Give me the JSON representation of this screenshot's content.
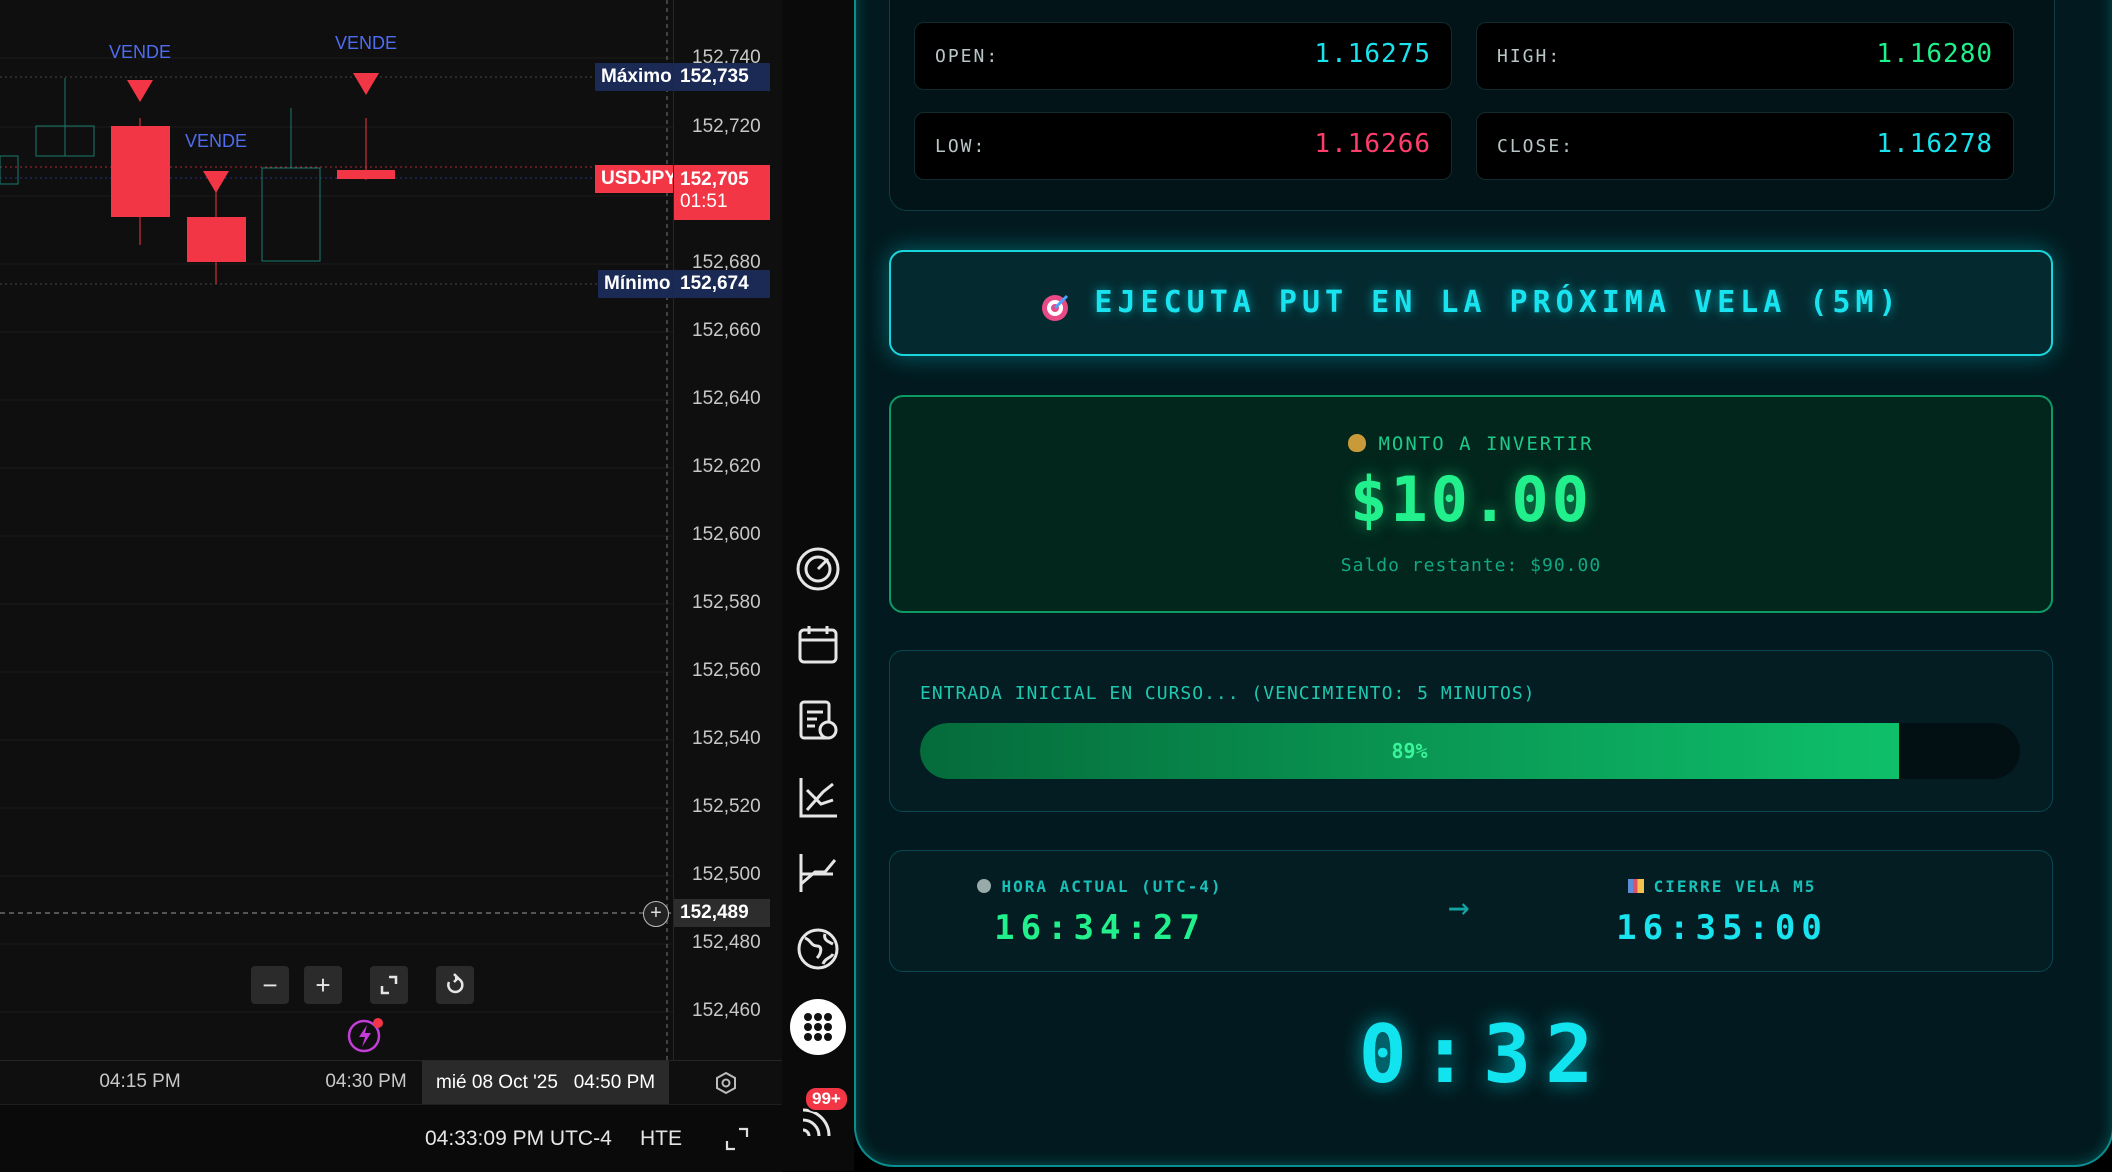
{
  "chart": {
    "signals": [
      "VENDE",
      "VENDE",
      "VENDE"
    ],
    "price_ticks": [
      "152,740",
      "152,720",
      "152,680",
      "152,660",
      "152,640",
      "152,620",
      "152,600",
      "152,580",
      "152,560",
      "152,540",
      "152,520",
      "152,500",
      "152,480",
      "152,460"
    ],
    "max_label": "Máximo",
    "max_value": "152,735",
    "symbol": "USDJPY",
    "current_price": "152,705",
    "countdown": "01:51",
    "min_label": "Mínimo",
    "min_value": "152,674",
    "crosshair_price": "152,489",
    "time_ticks": [
      "04:15 PM",
      "04:30 PM"
    ],
    "time_current": "mié 08 Oct '25   04:50 PM",
    "clock": "04:33:09 PM UTC-4",
    "exchange": "HTE",
    "colors": {
      "bear": "#f23645",
      "bull": "#1a7a6e",
      "signal": "#4e6cf0"
    }
  },
  "toolbar": {
    "icons": [
      "speedometer-icon",
      "calendar-icon",
      "news-icon",
      "chart-pattern-icon",
      "indicator-icon",
      "globe-icon",
      "apps-grid-icon",
      "broadcast-icon"
    ],
    "badge": "99+"
  },
  "panel": {
    "ohlc": [
      {
        "label": "OPEN:",
        "value": "1.16275",
        "color": "#19e3ee"
      },
      {
        "label": "HIGH:",
        "value": "1.16280",
        "color": "#1ef08a"
      },
      {
        "label": "LOW:",
        "value": "1.16266",
        "color": "#ff3d6b"
      },
      {
        "label": "CLOSE:",
        "value": "1.16278",
        "color": "#19e3ee"
      }
    ],
    "signal": {
      "icon": "target-icon",
      "text": "EJECUTA PUT EN LA PRÓXIMA VELA (5M)"
    },
    "amount": {
      "icon": "money-bag-icon",
      "label": "MONTO A INVERTIR",
      "value": "$10.00",
      "balance": "Saldo restante: $90.00"
    },
    "progress": {
      "label": "ENTRADA INICIAL EN CURSO... (VENCIMIENTO: 5 MINUTOS)",
      "percent": 89,
      "text": "89%"
    },
    "time": {
      "current_label": "HORA ACTUAL (UTC-4)",
      "current_value": "16:34:27",
      "arrow": "→",
      "close_label": "CIERRE VELA M5",
      "close_value": "16:35:00"
    },
    "countdown": "0:32"
  }
}
